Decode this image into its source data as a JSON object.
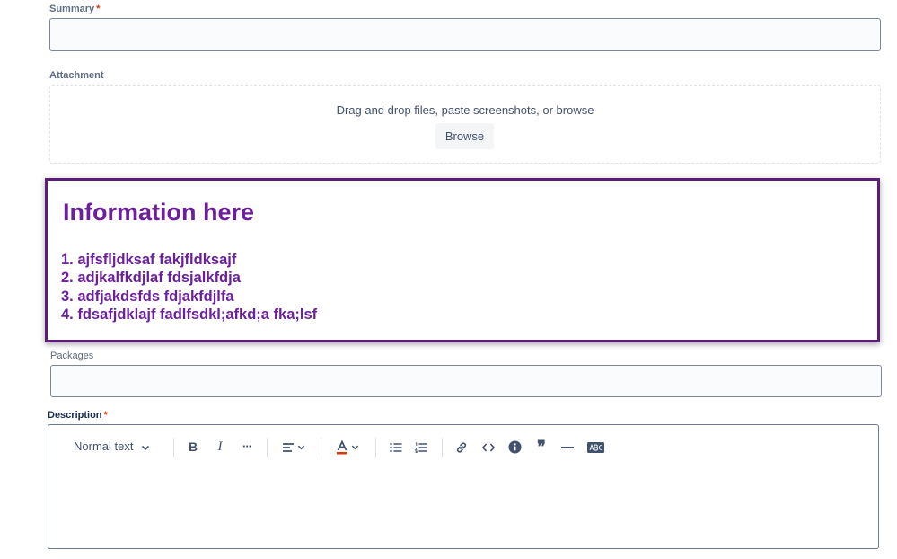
{
  "summary": {
    "label": "Summary",
    "required": "*"
  },
  "attachment": {
    "label": "Attachment",
    "dropzone_text": "Drag and drop files, paste screenshots, or browse",
    "browse_label": "Browse"
  },
  "info_box": {
    "title": "Information here",
    "items": [
      "1. ajfsfljdksaf fakjfldksajf",
      "2. adjkalfkdjlaf fdsjalkfdja",
      "3. adfjakdsfds fdjakfdjlfa",
      "4. fdsafjdklajf fadlfsdkl;afkd;a fka;lsf"
    ],
    "accent_color": "#6b1f9a",
    "border_color": "#5c1e7a"
  },
  "packages": {
    "label": "Packages"
  },
  "description": {
    "label": "Description",
    "required": "*",
    "toolbar": {
      "text_style": "Normal text",
      "bold": "B",
      "italic": "I",
      "more": "···",
      "quote": "❞",
      "icons": [
        "chevron-down-icon",
        "bold-icon",
        "italic-icon",
        "more-icon",
        "align-icon",
        "text-color-icon",
        "bullet-list-icon",
        "numbered-list-icon",
        "link-icon",
        "code-icon",
        "info-icon",
        "quote-icon",
        "divider-icon",
        "spellcheck-icon"
      ]
    }
  }
}
